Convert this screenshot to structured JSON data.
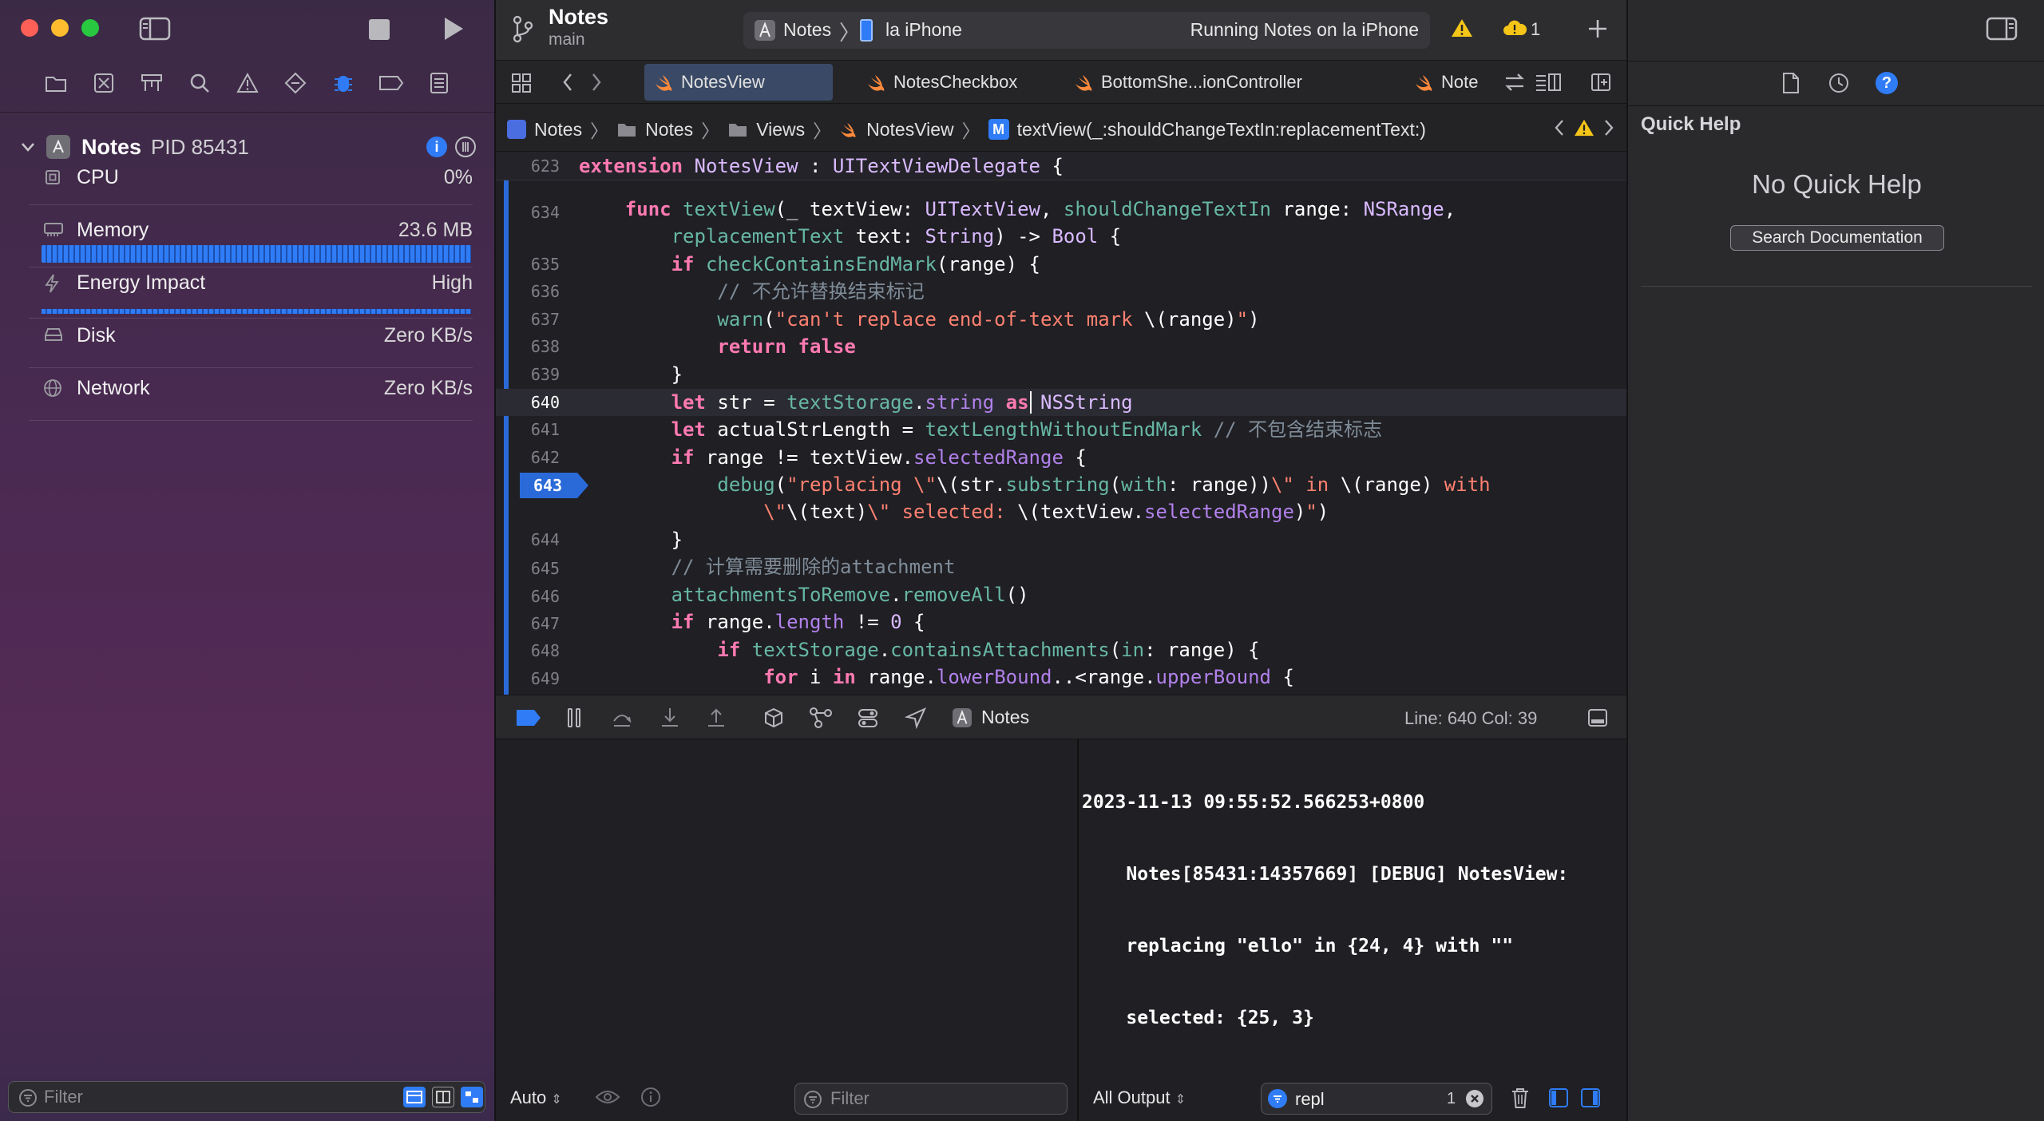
{
  "window": {
    "project_name": "Notes",
    "branch": "main",
    "scheme": "Notes",
    "device": "la iPhone",
    "status": "Running Notes on la iPhone",
    "warning_count": "1"
  },
  "sidebar": {
    "process_name": "Notes",
    "pid": "PID 85431",
    "gauges": [
      {
        "label": "CPU",
        "value": "0%"
      },
      {
        "label": "Memory",
        "value": "23.6 MB"
      },
      {
        "label": "Energy Impact",
        "value": "High"
      },
      {
        "label": "Disk",
        "value": "Zero KB/s"
      },
      {
        "label": "Network",
        "value": "Zero KB/s"
      }
    ],
    "filter_placeholder": "Filter"
  },
  "tabs": [
    {
      "label": "NotesView"
    },
    {
      "label": "NotesCheckbox"
    },
    {
      "label": "BottomShe...ionController"
    },
    {
      "label": "Note"
    }
  ],
  "breadcrumb": [
    "Notes",
    "Notes",
    "Views",
    "NotesView",
    "textView(_:shouldChangeTextIn:replacementText:)"
  ],
  "editor": {
    "sticky_line_number": "623",
    "cursor_line": "640",
    "breakpoint_line": "643",
    "line_numbers": [
      "634",
      "635",
      "636",
      "637",
      "638",
      "639",
      "640",
      "641",
      "642",
      "643",
      "644",
      "645",
      "646",
      "647",
      "648",
      "649"
    ]
  },
  "debug_bar": {
    "target": "Notes",
    "line_col": "Line: 640  Col: 39"
  },
  "variables": {
    "scope": "Auto",
    "filter_placeholder": "Filter"
  },
  "console": {
    "log_lines": [
      "2023-11-13 09:55:52.566253+0800",
      "    Notes[85431:14357669] [DEBUG] NotesView:",
      "    replacing \"ello\" in {24, 4} with \"\"",
      "    selected: {25, 3}"
    ],
    "output_scope": "All Output",
    "search_value": "repl",
    "match_count": "1"
  },
  "inspector": {
    "title": "Quick Help",
    "empty_message": "No Quick Help",
    "search_button": "Search Documentation"
  },
  "colors": {
    "accent": "#2f7cf6",
    "breakpoint": "#2a6ad8",
    "keyword": "#ff7ab2",
    "string": "#ff8170",
    "comment": "#7f8c98"
  }
}
